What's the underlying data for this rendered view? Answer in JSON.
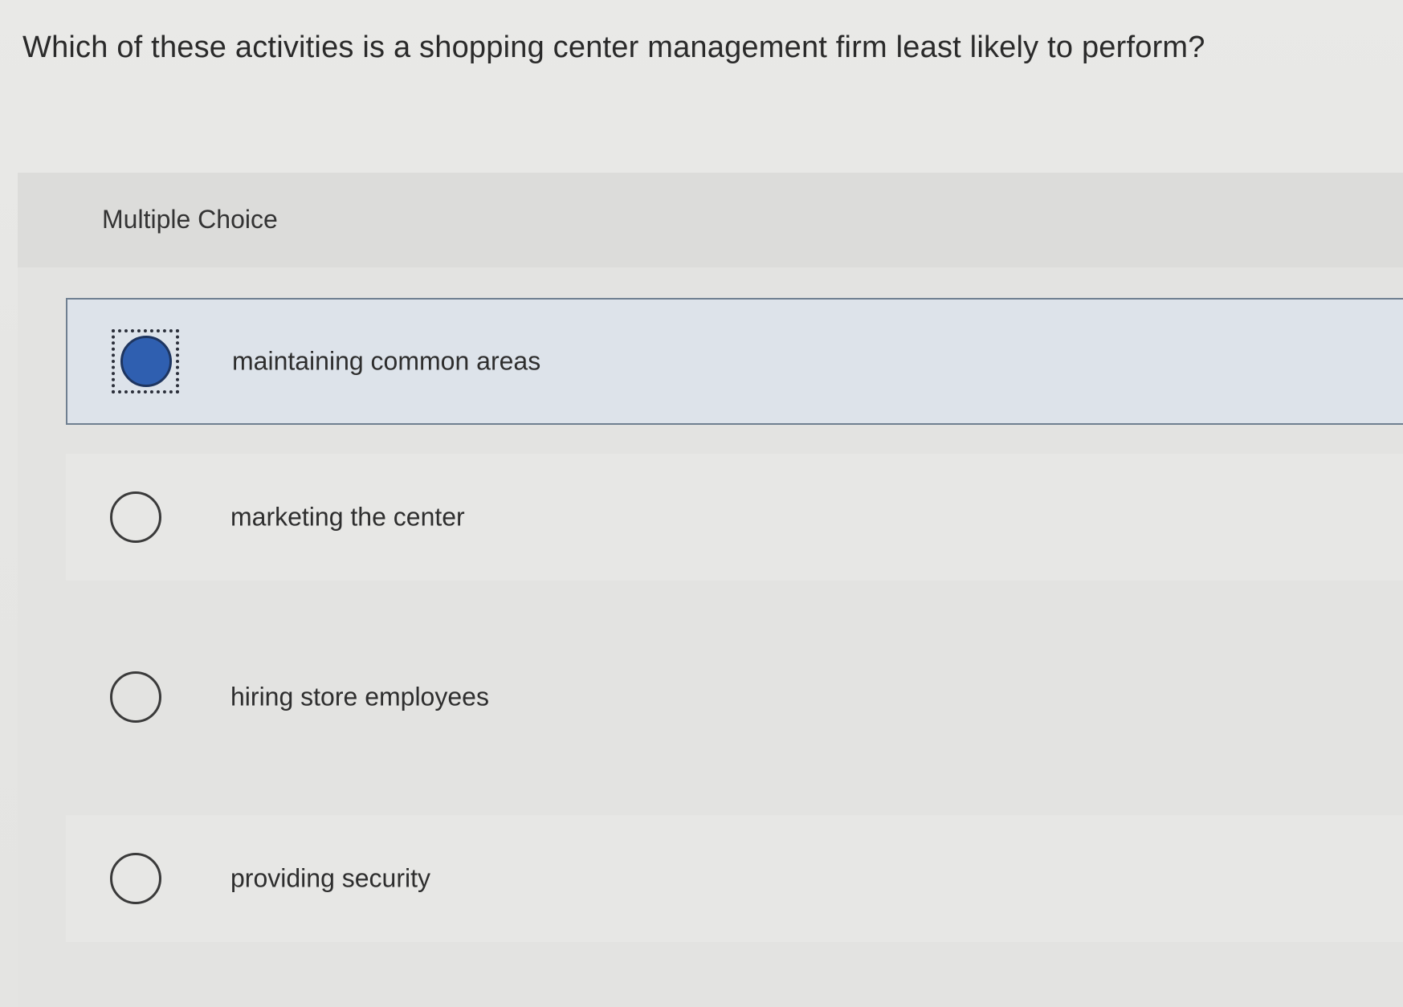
{
  "question": "Which of these activities is a shopping center management firm least likely to perform?",
  "section_label": "Multiple Choice",
  "options": [
    {
      "label": "maintaining common areas",
      "selected": true
    },
    {
      "label": "marketing the center",
      "selected": false
    },
    {
      "label": "hiring store employees",
      "selected": false
    },
    {
      "label": "providing security",
      "selected": false
    }
  ],
  "colors": {
    "selected_fill": "#2f5fb0",
    "selected_row_bg": "#dde3ea",
    "page_bg": "#e8e8e6"
  }
}
